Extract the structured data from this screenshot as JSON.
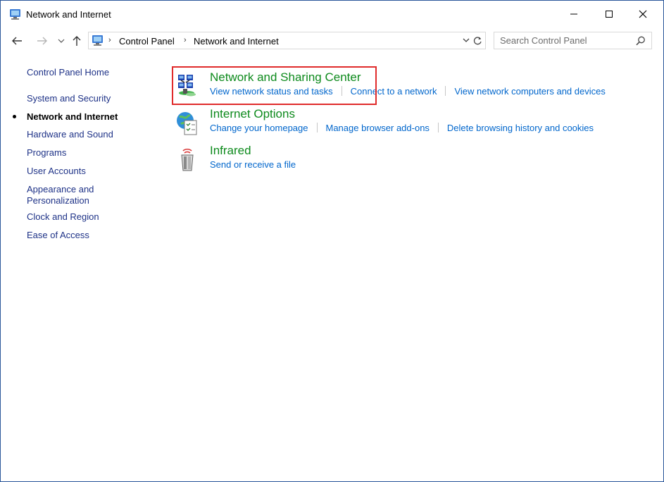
{
  "window": {
    "title": "Network and Internet"
  },
  "address": {
    "breadcrumbs": [
      "Control Panel",
      "Network and Internet"
    ]
  },
  "search": {
    "placeholder": "Search Control Panel"
  },
  "leftnav": {
    "home": "Control Panel Home",
    "items": [
      {
        "label": "System and Security",
        "current": false
      },
      {
        "label": "Network and Internet",
        "current": true
      },
      {
        "label": "Hardware and Sound",
        "current": false
      },
      {
        "label": "Programs",
        "current": false
      },
      {
        "label": "User Accounts",
        "current": false
      },
      {
        "label": "Appearance and Personalization",
        "current": false,
        "lines": [
          "Appearance and",
          "Personalization"
        ]
      },
      {
        "label": "Clock and Region",
        "current": false
      },
      {
        "label": "Ease of Access",
        "current": false
      }
    ]
  },
  "categories": [
    {
      "title": "Network and Sharing Center",
      "icon": "network-sharing-icon",
      "links": [
        "View network status and tasks",
        "Connect to a network",
        "View network computers and devices"
      ]
    },
    {
      "title": "Internet Options",
      "icon": "internet-options-icon",
      "links": [
        "Change your homepage",
        "Manage browser add-ons",
        "Delete browsing history and cookies"
      ]
    },
    {
      "title": "Infrared",
      "icon": "infrared-icon",
      "links": [
        "Send or receive a file"
      ]
    }
  ],
  "colors": {
    "heading": "#0d8a1c",
    "link": "#0066cc",
    "nav_link": "#1e3287",
    "highlight": "#e02b2b"
  }
}
